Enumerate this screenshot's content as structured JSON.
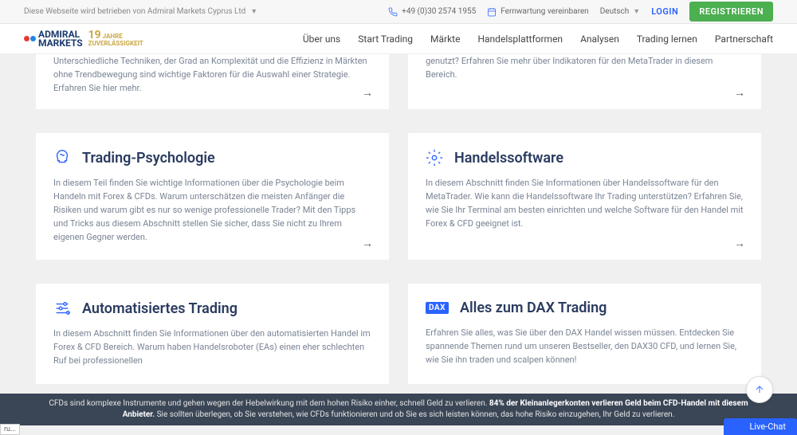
{
  "topbar": {
    "operated": "Diese Webseite wird betrieben von Admiral Markets Cyprus Ltd",
    "phone": "+49 (0)30 2574 1955",
    "remote": "Fernwartung vereinbaren",
    "lang": "Deutsch",
    "login": "LOGIN",
    "register": "REGISTRIEREN"
  },
  "logo": {
    "l1": "ADMIRAL",
    "l2": "MARKETS",
    "y1": "19",
    "y2": "JAHRE",
    "y3": "ZUVERLÄSSIGKEIT"
  },
  "nav": [
    "Über uns",
    "Start Trading",
    "Märkte",
    "Handelsplattformen",
    "Analysen",
    "Trading lernen",
    "Partnerschaft"
  ],
  "cards": {
    "p1": "Unterschiedliche Techniken, der Grad an Komplexität und die Effizienz in Märkten ohne Trendbewegung sind wichtige Faktoren für die Auswahl einer Strategie. Erfahren Sie hier mehr.",
    "p2": "genutzt? Erfahren Sie mehr über Indikatoren für den MetaTrader in diesem Bereich.",
    "c1": {
      "t": "Trading-Psychologie",
      "d": "In diesem Teil finden Sie wichtige Informationen über die Psychologie beim Handeln mit Forex & CFDs. Warum unterschätzen die meisten Anfänger die Risiken und warum gibt es nur so wenige professionelle Trader? Mit den Tipps und Tricks aus diesem Abschnitt stellen Sie sicher, dass Sie nicht zu Ihrem eigenen Gegner werden."
    },
    "c2": {
      "t": "Handelssoftware",
      "d": "In diesem Abschnitt finden Sie Informationen über Handelssoftware für den MetaTrader. Wie kann die Handelssoftware Ihr Trading unterstützen? Erfahren Sie, wie Sie Ihr Terminal am besten einrichten und welche Software für den Handel mit Forex & CFD geeignet ist."
    },
    "c3": {
      "t": "Automatisiertes Trading",
      "d": "In diesem Abschnitt finden Sie Informationen über den automatisierten Handel im Forex & CFD Bereich. Warum haben Handelsroboter (EAs) einen eher schlechten Ruf bei professionellen"
    },
    "c4": {
      "t": "Alles zum DAX Trading",
      "d": "Erfahren Sie alles, was Sie über den DAX Handel wissen müssen. Entdecken Sie spannende Themen rund um unseren Bestseller, den DAX30 CFD, und lernen Sie, wie Sie ihn traden und scalpen können!"
    }
  },
  "risk": {
    "a": "CFDs sind komplexe Instrumente und gehen wegen der Hebelwirkung mit dem hohen Risiko einher, schnell Geld zu verlieren. ",
    "b": "84% der Kleinanlegerkonten verlieren Geld beim CFD-Handel mit diesem Anbieter.",
    "c": " Sie sollten überlegen, ob Sie verstehen, wie CFDs funktionieren und ob Sie es sich leisten können, das hohe Risiko einzugehen, Ihr Geld zu verlieren."
  },
  "chat": "Live-Chat",
  "url": "ru..."
}
